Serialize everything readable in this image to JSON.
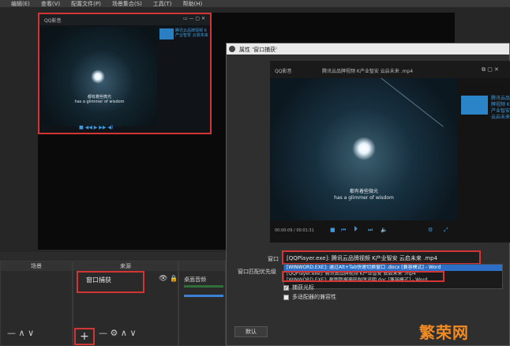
{
  "menu": [
    "编辑(E)",
    "查看(V)",
    "配置文件(P)",
    "场景集合(S)",
    "工具(T)",
    "帮助(H)"
  ],
  "mini": {
    "window_title": "QQ影音",
    "side_text": "腾讯云品牌视频 K产业智安 云启未来",
    "subtitle_cn": "都有着些微光",
    "subtitle_en": "has a glimmer of wisdom"
  },
  "dialog": {
    "title": "属性 '窗口捕获'",
    "player_app": "QQ影音",
    "player_title": "腾讯云品牌视频 K产业智安 云启未来 .mp4",
    "side_text": "腾讯云品牌视频 K产业智安 云启未来",
    "subtitle_cn": "都有着些微光",
    "subtitle_en": "has a glimmer of wisdom",
    "time": "00:00:09 / 00:01:31",
    "window_label": "窗口",
    "window_value": "[QQPlayer.exe]: 腾讯云品牌视频 K产业智安 云启未来 .mp4",
    "priority_label": "窗口匹配优先级",
    "dropdown_items": [
      "[WINWORD.EXE]: 通过Alt+Tab快速切换窗口 .docx [兼容模式] - Word",
      "[QQPlayer.exe]: 腾讯云品牌视频 K产业智安 云启未来 .mp4",
      "[WINWORD.EXE]: 截图数据捕获程序说明.doc [兼容模式] - Word"
    ],
    "check_cursor": "捕获光标",
    "check_multi": "多适配器的兼容性",
    "defaults_button": "默认"
  },
  "docks": {
    "scenes_header": "场景",
    "sources_header": "来源",
    "source_item": "窗口捕获",
    "audio_item": "桌面音频"
  },
  "watermark": "繁荣网"
}
